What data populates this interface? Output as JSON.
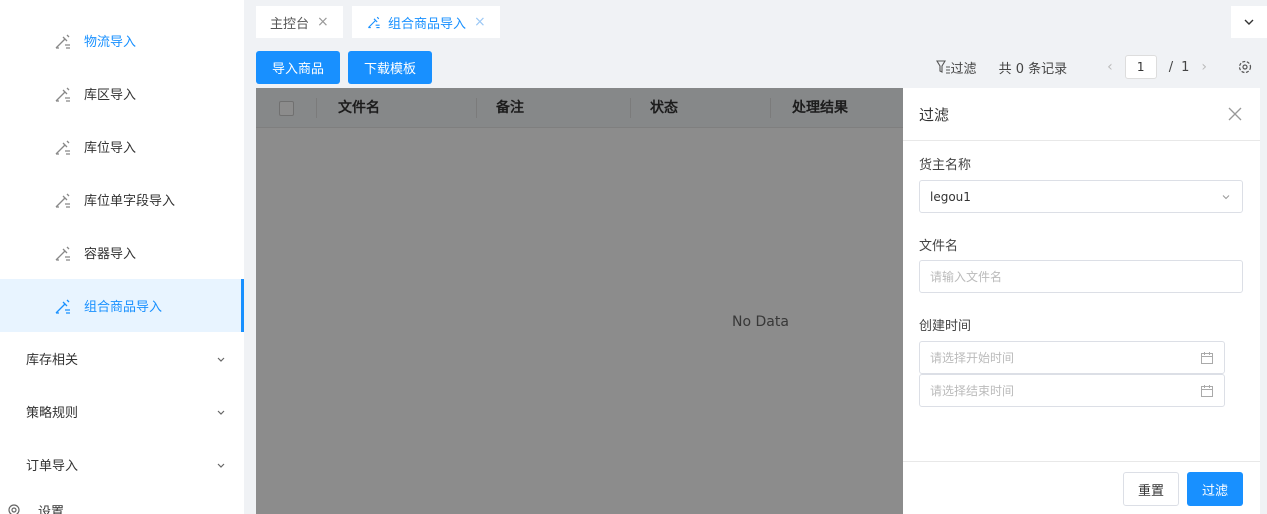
{
  "sidebar": {
    "items": [
      {
        "label": "物流导入",
        "icon": "import-icon"
      },
      {
        "label": "库区导入",
        "icon": "import-icon"
      },
      {
        "label": "库位导入",
        "icon": "import-icon"
      },
      {
        "label": "库位单字段导入",
        "icon": "import-icon"
      },
      {
        "label": "容器导入",
        "icon": "import-icon"
      },
      {
        "label": "组合商品导入",
        "icon": "import-icon",
        "active": true
      }
    ],
    "groups": [
      {
        "label": "库存相关"
      },
      {
        "label": "策略规则"
      },
      {
        "label": "订单导入"
      }
    ],
    "bottom_label": "设置"
  },
  "tabs": [
    {
      "label": "主控台"
    },
    {
      "label": "组合商品导入",
      "active": true
    }
  ],
  "toolbar": {
    "import_label": "导入商品",
    "download_label": "下载模板",
    "filter_label": "过滤",
    "total_label": "共 0 条记录",
    "page_current": "1",
    "page_total": "1"
  },
  "table": {
    "columns": [
      "文件名",
      "备注",
      "状态",
      "处理结果"
    ],
    "empty_text": "No Data"
  },
  "drawer": {
    "title": "过滤",
    "fields": {
      "owner_label": "货主名称",
      "owner_value": "legou1",
      "filename_label": "文件名",
      "filename_placeholder": "请输入文件名",
      "created_label": "创建时间",
      "start_placeholder": "请选择开始时间",
      "end_placeholder": "请选择结束时间"
    },
    "reset_label": "重置",
    "submit_label": "过滤"
  },
  "colors": {
    "primary": "#1890ff",
    "active_bg": "#e8f4ff"
  }
}
